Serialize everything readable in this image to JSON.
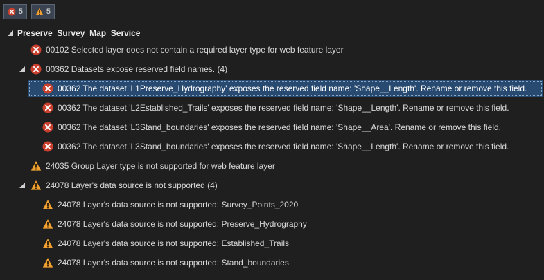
{
  "toolbar": {
    "errors_count": "5",
    "warnings_count": "5"
  },
  "tree": {
    "root": "Preserve_Survey_Map_Service",
    "items": [
      {
        "type": "error",
        "text": "00102 Selected layer does not contain a required layer type for web feature layer"
      },
      {
        "type": "error",
        "text": "00362 Datasets expose reserved field names. (4)"
      },
      {
        "type": "error",
        "text": "00362 The dataset 'L1Preserve_Hydrography' exposes the reserved field name: 'Shape__Length'.  Rename or remove this field."
      },
      {
        "type": "error",
        "text": "00362 The dataset 'L2Established_Trails' exposes the reserved field name: 'Shape__Length'.  Rename or remove this field."
      },
      {
        "type": "error",
        "text": "00362 The dataset 'L3Stand_boundaries' exposes the reserved field name: 'Shape__Area'.  Rename or remove this field."
      },
      {
        "type": "error",
        "text": "00362 The dataset 'L3Stand_boundaries' exposes the reserved field name: 'Shape__Length'.  Rename or remove this field."
      },
      {
        "type": "warning",
        "text": "24035 Group Layer type is not supported for web feature layer"
      },
      {
        "type": "warning",
        "text": "24078 Layer's data source is not supported (4)"
      },
      {
        "type": "warning",
        "text": "24078 Layer's data source is not supported: Survey_Points_2020"
      },
      {
        "type": "warning",
        "text": "24078 Layer's data source is not supported: Preserve_Hydrography"
      },
      {
        "type": "warning",
        "text": "24078 Layer's data source is not supported: Established_Trails"
      },
      {
        "type": "warning",
        "text": "24078 Layer's data source is not supported: Stand_boundaries"
      }
    ]
  },
  "colors": {
    "error": "#c9402e",
    "warning": "#f0a030",
    "selection": "#284a70",
    "background": "#1f1f1f"
  }
}
